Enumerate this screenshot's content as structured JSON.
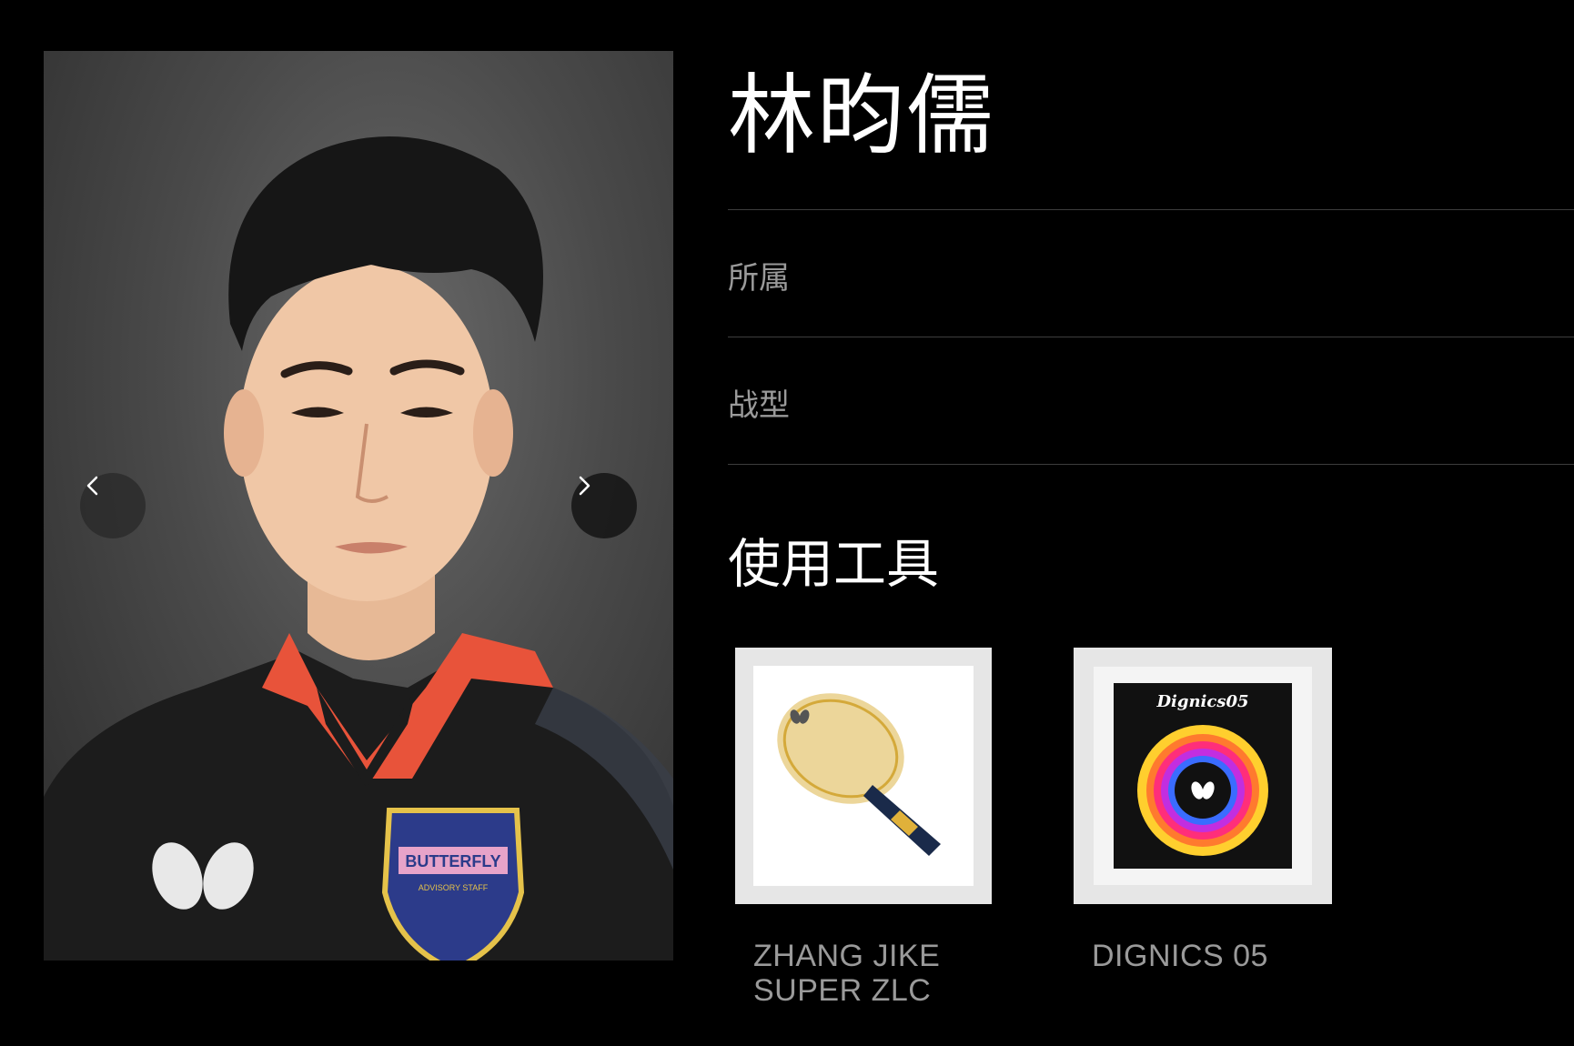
{
  "player": {
    "name": "林昀儒",
    "photo_alt": "player-portrait",
    "jersey_badge_text": "BUTTERFLY",
    "jersey_badge_subtext": "ADVISORY STAFF"
  },
  "fields": [
    {
      "label": "所属",
      "value": ""
    },
    {
      "label": "战型",
      "value": ""
    }
  ],
  "tools": {
    "heading": "使用工具",
    "items": [
      {
        "name": "ZHANG JIKE\nSUPER ZLC",
        "kind": "blade"
      },
      {
        "name": "DIGNICS 05",
        "kind": "rubber",
        "package_text": "Dignics05"
      }
    ]
  },
  "colors": {
    "background": "#000000",
    "muted_text": "#9a9a9a",
    "divider": "#3d3d3d",
    "collar_accent": "#e8533a"
  }
}
